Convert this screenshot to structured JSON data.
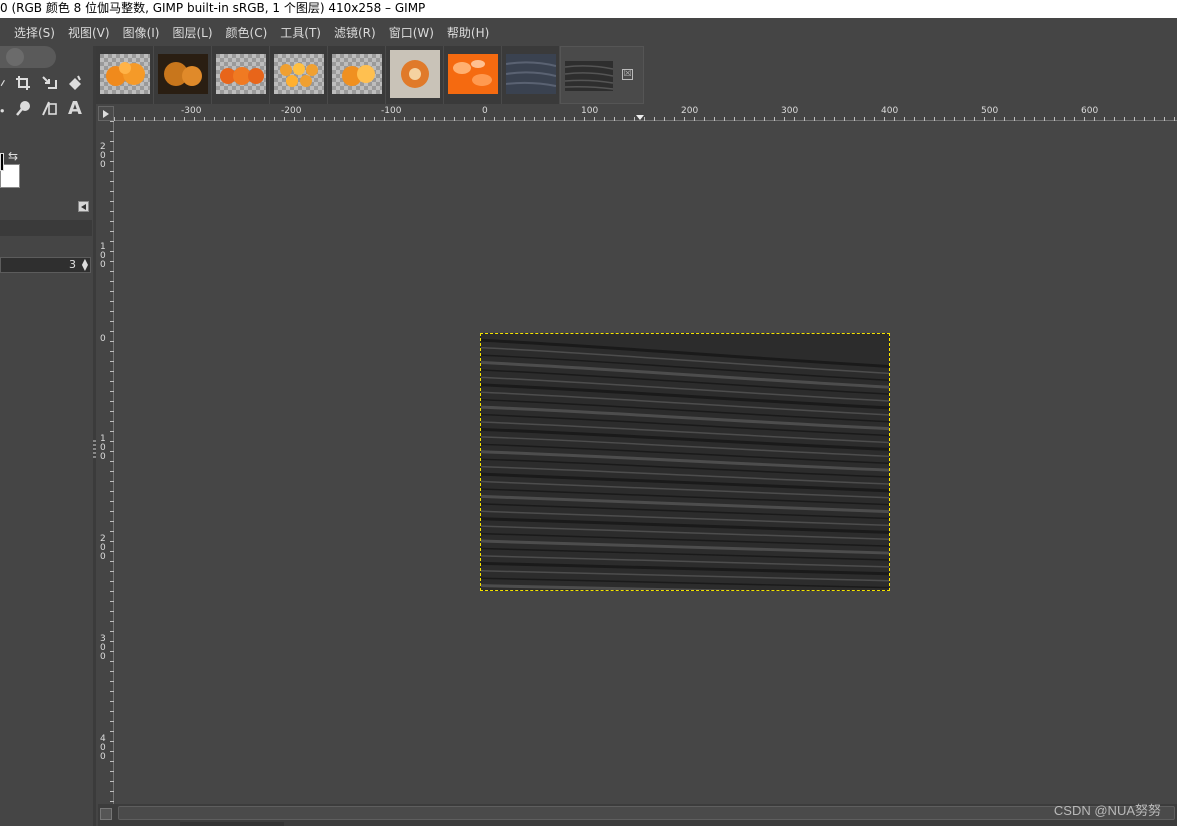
{
  "window": {
    "title": "0 (RGB 颜色 8 位伽马整数, GIMP built-in sRGB, 1 个图层) 410x258 – GIMP"
  },
  "menu": [
    {
      "label": "选择(S)"
    },
    {
      "label": "视图(V)"
    },
    {
      "label": "图像(I)"
    },
    {
      "label": "图层(L)"
    },
    {
      "label": "颜色(C)"
    },
    {
      "label": "工具(T)"
    },
    {
      "label": "滤镜(R)"
    },
    {
      "label": "窗口(W)"
    },
    {
      "label": "帮助(H)"
    }
  ],
  "toolbox": {
    "tools": [
      "crop-icon",
      "transform-icon",
      "bucket-fill-icon",
      "paintbrush-icon",
      "smudge-icon",
      "clone-icon",
      "text-icon"
    ],
    "text_tool_glyph": "A",
    "tool_option_value": "3",
    "colors": {
      "foreground": "#000000",
      "background": "#ffffff"
    }
  },
  "image_tabs": [
    {
      "name": "oranges-1",
      "colors": [
        "#f08a1c",
        "#ffb347"
      ],
      "transparent": true
    },
    {
      "name": "oranges-2",
      "colors": [
        "#c8761c",
        "#3a2a18"
      ],
      "transparent": false
    },
    {
      "name": "oranges-3",
      "colors": [
        "#e8651a",
        "#ffa040"
      ],
      "transparent": true
    },
    {
      "name": "oranges-4",
      "colors": [
        "#f0a030",
        "#ffd060"
      ],
      "transparent": true
    },
    {
      "name": "oranges-5",
      "colors": [
        "#f09020",
        "#ffc050"
      ],
      "transparent": true
    },
    {
      "name": "orange-peeled",
      "colors": [
        "#e07a2a",
        "#c9c3b8"
      ],
      "transparent": false
    },
    {
      "name": "orange-segments",
      "colors": [
        "#f56a10",
        "#ffb070"
      ],
      "transparent": false
    },
    {
      "name": "wood-dark-1",
      "colors": [
        "#3a4250",
        "#4e5666"
      ],
      "transparent": false
    },
    {
      "name": "wood-dark-2",
      "colors": [
        "#2e2e2e",
        "#505050"
      ],
      "transparent": false,
      "active": true
    }
  ],
  "tab_close_glyph": "☒",
  "rulers": {
    "horizontal": [
      "-300",
      "-200",
      "-100",
      "0",
      "100",
      "200",
      "300",
      "400",
      "500",
      "600"
    ],
    "vertical": [
      "200",
      "100",
      "0",
      "100",
      "200",
      "300",
      "400"
    ]
  },
  "canvas": {
    "image_size": "410x258",
    "selection_color": "#f5e300"
  },
  "watermark": "CSDN @NUA努努"
}
